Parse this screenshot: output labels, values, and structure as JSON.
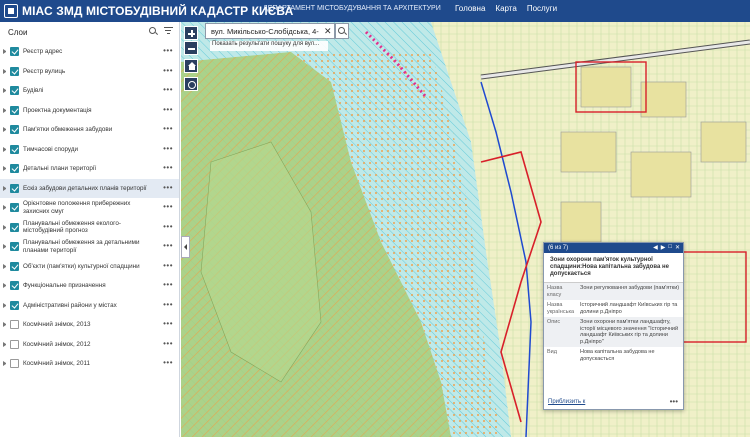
{
  "header": {
    "title": "МІАС ЗМД МІСТОБУДІВНИЙ КАДАСТР КИЄВА",
    "department": "ДЕПАРТАМЕНТ МІСТОБУДУВАННЯ ТА АРХІТЕКТУРИ",
    "nav": [
      "Головна",
      "Карта",
      "Послуги"
    ],
    "color": "#1f4a8c"
  },
  "sidebar": {
    "title": "Слои",
    "layers": [
      {
        "label": "Реєстр адрес",
        "checked": true,
        "expandable": true
      },
      {
        "label": "Реєстр вулиць",
        "checked": true,
        "expandable": true
      },
      {
        "label": "Будівлі",
        "checked": true,
        "expandable": true
      },
      {
        "label": "Проектна документація",
        "checked": true,
        "expandable": true
      },
      {
        "label": "Пам'ятки обмеження забудови",
        "checked": true,
        "expandable": true
      },
      {
        "label": "Тимчасові споруди",
        "checked": true,
        "expandable": true
      },
      {
        "label": "Детальні плани території",
        "checked": true,
        "expandable": true
      },
      {
        "label": "Ескіз забудови детальних планів території",
        "checked": true,
        "expandable": true,
        "selected": true
      },
      {
        "label": "Орієнтовне положення прибережних захисних смуг",
        "checked": true,
        "expandable": true
      },
      {
        "label": "Планувальні обмеження еколого-містобудівний прогноз",
        "checked": true,
        "expandable": true
      },
      {
        "label": "Планувальні обмеження за детальними планами території",
        "checked": true,
        "expandable": true
      },
      {
        "label": "Об'єкти (пам'ятки) культурної спадщини",
        "checked": true,
        "expandable": true
      },
      {
        "label": "Функціональне призначення",
        "checked": true,
        "expandable": true
      },
      {
        "label": "Адміністративні райони у містах",
        "checked": true,
        "expandable": true
      },
      {
        "label": "Космічний знімок, 2013",
        "checked": false,
        "expandable": true
      },
      {
        "label": "Космічний знімок, 2012",
        "checked": false,
        "expandable": true
      },
      {
        "label": "Космічний знімок, 2011",
        "checked": false,
        "expandable": true
      }
    ]
  },
  "search": {
    "value": "вул. Микільсько-Слобідська, 4-",
    "hint": "Показать результати пошуку для вул..."
  },
  "popup": {
    "counter": "(6 из 7)",
    "title": "Зони охорони пам'яток культурної спадщини:Нова капітальна забудова не допускається",
    "rows": [
      {
        "key": "Назва класу",
        "value": "Зони регулювання забудови (пам'ятки)"
      },
      {
        "key": "Назва українська",
        "value": "Історичний ландшафт Київських гір та долини р.Дніпро"
      },
      {
        "key": "Опис",
        "value": "Зони охорони пам'ятки ландшафту, історії місцевого значення \"Історичний ландшафт Київських гір та долини р.Дніпро\""
      },
      {
        "key": "Вид",
        "value": "Нова капітальна забудова не допускається"
      }
    ],
    "zoom_link": "Приблизить к"
  },
  "map_colors": {
    "water": "#bfe9e8",
    "park": "#a8cf80",
    "urban": "#f0f0c8",
    "hatch_orange": "#f39c40",
    "hatch_cyan": "#5bc8d8",
    "boundary_red": "#d8202a"
  }
}
